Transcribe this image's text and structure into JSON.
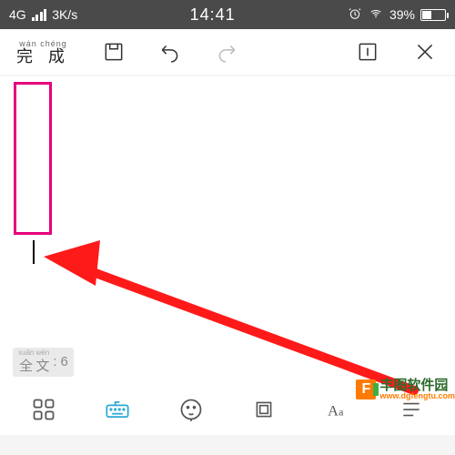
{
  "status": {
    "network_type": "4G",
    "data_rate": "3K/s",
    "time": "14:41",
    "battery_pct": "39%"
  },
  "toolbar": {
    "done_pinyin": "wán chéng",
    "done_label": "完 成"
  },
  "canvas": {
    "selection_pinyin1": "xuǎn",
    "selection_pinyin2": "wén",
    "selection_h1": "全",
    "selection_h2": "文",
    "selection_count": "6"
  },
  "watermark": {
    "title": "丰图软件园",
    "url": "www.dgfengtu.com"
  },
  "icons": {
    "save": "save-icon",
    "undo": "undo-icon",
    "redo": "redo-icon",
    "info": "info-icon",
    "close": "close-icon",
    "grid": "grid-icon",
    "keyboard": "keyboard-icon",
    "face": "face-icon",
    "crop": "crop-icon",
    "text_format": "text-format",
    "list": "list-icon"
  }
}
